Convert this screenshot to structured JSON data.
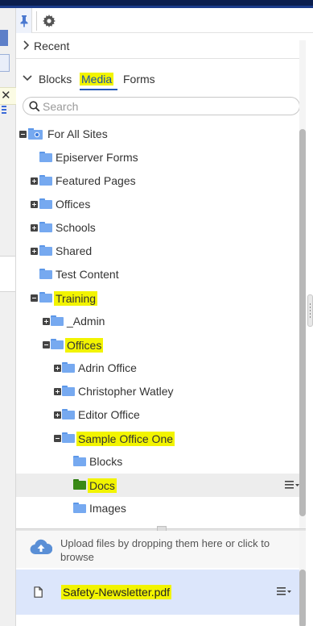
{
  "toolbar": {
    "pin_icon": "pin-icon",
    "settings_icon": "gear-icon"
  },
  "recent": {
    "label": "Recent"
  },
  "tabs": [
    {
      "label": "Blocks",
      "active": false
    },
    {
      "label": "Media",
      "active": true
    },
    {
      "label": "Forms",
      "active": false
    }
  ],
  "search": {
    "placeholder": "Search",
    "value": ""
  },
  "tree": [
    {
      "label": "For All Sites",
      "level": 0,
      "expander": "minus",
      "icon": "site-folder-icon"
    },
    {
      "label": "Episerver Forms",
      "level": 1,
      "expander": "none",
      "icon": "folder-icon"
    },
    {
      "label": "Featured Pages",
      "level": 1,
      "expander": "plus",
      "icon": "folder-icon"
    },
    {
      "label": "Offices",
      "level": 1,
      "expander": "plus",
      "icon": "folder-icon"
    },
    {
      "label": "Schools",
      "level": 1,
      "expander": "plus",
      "icon": "folder-icon"
    },
    {
      "label": "Shared",
      "level": 1,
      "expander": "plus",
      "icon": "folder-icon"
    },
    {
      "label": "Test Content",
      "level": 1,
      "expander": "none",
      "icon": "folder-icon"
    },
    {
      "label": "Training",
      "level": 1,
      "expander": "minus",
      "icon": "folder-icon",
      "highlighted": true
    },
    {
      "label": "_Admin",
      "level": 2,
      "expander": "plus",
      "icon": "folder-icon"
    },
    {
      "label": "Offices",
      "level": 2,
      "expander": "minus",
      "icon": "folder-icon",
      "highlighted": true
    },
    {
      "label": "Adrin Office",
      "level": 3,
      "expander": "plus",
      "icon": "folder-icon"
    },
    {
      "label": "Christopher Watley",
      "level": 3,
      "expander": "plus",
      "icon": "folder-icon"
    },
    {
      "label": "Editor Office",
      "level": 3,
      "expander": "plus",
      "icon": "folder-icon"
    },
    {
      "label": "Sample Office One",
      "level": 3,
      "expander": "minus",
      "icon": "folder-icon",
      "highlighted": true
    },
    {
      "label": "Blocks",
      "level": 4,
      "expander": "none",
      "icon": "folder-icon"
    },
    {
      "label": "Docs",
      "level": 4,
      "expander": "none",
      "icon": "folder-icon",
      "highlighted": true,
      "selected": true
    },
    {
      "label": "Images",
      "level": 4,
      "expander": "none",
      "icon": "folder-icon"
    }
  ],
  "upload": {
    "text": "Upload files by dropping them here or click to browse"
  },
  "files": [
    {
      "name": "Safety-Newsletter.pdf",
      "highlighted": true
    }
  ],
  "colors": {
    "highlight": "#f2f400",
    "folder": "#76a9f0",
    "selected_folder": "#3a8a17",
    "file_selected_bg": "#dce6fb",
    "accent": "#2457b8"
  }
}
